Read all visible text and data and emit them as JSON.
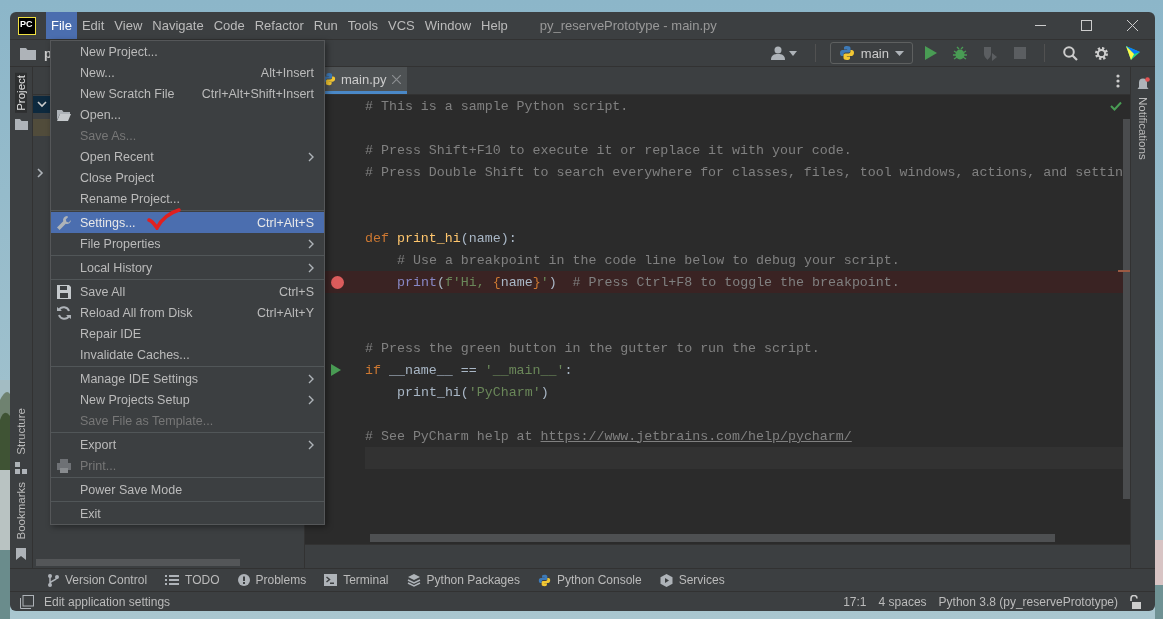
{
  "window": {
    "logo": "PC",
    "title": "py_reservePrototype - main.py"
  },
  "menu_bar": [
    {
      "label": "File",
      "selected": true
    },
    {
      "label": "Edit",
      "selected": false
    },
    {
      "label": "View",
      "selected": false
    },
    {
      "label": "Navigate",
      "selected": false
    },
    {
      "label": "Code",
      "selected": false
    },
    {
      "label": "Refactor",
      "selected": false
    },
    {
      "label": "Run",
      "selected": false
    },
    {
      "label": "Tools",
      "selected": false
    },
    {
      "label": "VCS",
      "selected": false
    },
    {
      "label": "Window",
      "selected": false
    },
    {
      "label": "Help",
      "selected": false
    }
  ],
  "navigation_bar": {
    "breadcrumb": "p"
  },
  "toolbar": {
    "run_configuration": "main"
  },
  "left_tool_stripe": [
    {
      "label": "Project",
      "selected": true
    },
    {
      "label": "Structure",
      "selected": false
    },
    {
      "label": "Bookmarks",
      "selected": false
    }
  ],
  "right_tool_stripe": [
    {
      "label": "Notifications",
      "selected": false
    }
  ],
  "editor": {
    "tabs": [
      {
        "label": "main.py",
        "selected": true
      }
    ],
    "lines": [
      {
        "kind": "code",
        "segments": [
          {
            "text": "# This is a sample Python script.",
            "kind": "comment"
          }
        ]
      },
      {
        "kind": "blank"
      },
      {
        "kind": "code",
        "segments": [
          {
            "text": "# Press Shift+F10 to execute it or replace it with your code.",
            "kind": "comment"
          }
        ]
      },
      {
        "kind": "code",
        "segments": [
          {
            "text": "# Press Double Shift to search everywhere for classes, files, tool windows, actions, and settin",
            "kind": "comment"
          }
        ]
      },
      {
        "kind": "blank"
      },
      {
        "kind": "blank"
      },
      {
        "kind": "code",
        "segments": [
          {
            "text": "def ",
            "kind": "keyword"
          },
          {
            "text": "print_hi",
            "kind": "function"
          },
          {
            "text": "(name):",
            "kind": "plain"
          }
        ],
        "children": [
          {
            "kind": "code",
            "segments": [
              {
                "text": "# Use a breakpoint in the code line below to debug your script.",
                "kind": "comment"
              }
            ]
          },
          {
            "kind": "breakpoint",
            "segments": [
              {
                "text": "print",
                "kind": "builtin"
              },
              {
                "text": "(",
                "kind": "plain"
              },
              {
                "text": "f'Hi, ",
                "kind": "string"
              },
              {
                "text": "{",
                "kind": "keyword"
              },
              {
                "text": "name",
                "kind": "plain"
              },
              {
                "text": "}",
                "kind": "keyword"
              },
              {
                "text": "'",
                "kind": "string"
              },
              {
                "text": ")  ",
                "kind": "plain"
              },
              {
                "text": "# Press Ctrl+F8 to toggle the breakpoint.",
                "kind": "comment"
              }
            ]
          }
        ]
      },
      {
        "kind": "blank"
      },
      {
        "kind": "blank"
      },
      {
        "kind": "code",
        "segments": [
          {
            "text": "# Press the green button in the gutter to run the script.",
            "kind": "comment"
          }
        ]
      },
      {
        "kind": "run",
        "segments": [
          {
            "text": "if",
            "kind": "keyword"
          },
          {
            "text": " __name__ == ",
            "kind": "plain"
          },
          {
            "text": "'__main__'",
            "kind": "string"
          },
          {
            "text": ":",
            "kind": "plain"
          }
        ],
        "children": [
          {
            "kind": "code",
            "segments": [
              {
                "text": "print_hi(",
                "kind": "plain"
              },
              {
                "text": "'PyCharm'",
                "kind": "string"
              },
              {
                "text": ")",
                "kind": "plain"
              }
            ]
          }
        ]
      },
      {
        "kind": "blank"
      },
      {
        "kind": "code",
        "segments": [
          {
            "text": "# See PyCharm help at ",
            "kind": "comment"
          },
          {
            "text": "https://www.jetbrains.com/help/pycharm/",
            "kind": "link"
          }
        ]
      },
      {
        "kind": "current"
      }
    ]
  },
  "file_menu": [
    {
      "kind": "item",
      "label": "New Project...",
      "disabled": false,
      "selected": false,
      "submenu": false,
      "annotated": false
    },
    {
      "kind": "item",
      "label": "New...",
      "shortcut": "Alt+Insert",
      "disabled": false,
      "selected": false,
      "submenu": false,
      "annotated": false
    },
    {
      "kind": "item",
      "label": "New Scratch File",
      "shortcut": "Ctrl+Alt+Shift+Insert",
      "disabled": false,
      "selected": false,
      "submenu": false,
      "annotated": false
    },
    {
      "kind": "item",
      "label": "Open...",
      "disabled": false,
      "selected": false,
      "submenu": false,
      "annotated": false
    },
    {
      "kind": "item",
      "label": "Save As...",
      "disabled": true,
      "selected": false,
      "submenu": false,
      "annotated": false
    },
    {
      "kind": "item",
      "label": "Open Recent",
      "disabled": false,
      "selected": false,
      "submenu": true,
      "annotated": false
    },
    {
      "kind": "item",
      "label": "Close Project",
      "disabled": false,
      "selected": false,
      "submenu": false,
      "annotated": false
    },
    {
      "kind": "item",
      "label": "Rename Project...",
      "disabled": false,
      "selected": false,
      "submenu": false,
      "annotated": false
    },
    {
      "kind": "separator"
    },
    {
      "kind": "item",
      "label": "Settings...",
      "shortcut": "Ctrl+Alt+S",
      "disabled": false,
      "selected": true,
      "submenu": false,
      "annotated": true
    },
    {
      "kind": "item",
      "label": "File Properties",
      "disabled": false,
      "selected": false,
      "submenu": true,
      "annotated": false
    },
    {
      "kind": "separator"
    },
    {
      "kind": "item",
      "label": "Local History",
      "disabled": false,
      "selected": false,
      "submenu": true,
      "annotated": false
    },
    {
      "kind": "separator"
    },
    {
      "kind": "item",
      "label": "Save All",
      "shortcut": "Ctrl+S",
      "disabled": false,
      "selected": false,
      "submenu": false,
      "annotated": false
    },
    {
      "kind": "item",
      "label": "Reload All from Disk",
      "shortcut": "Ctrl+Alt+Y",
      "disabled": false,
      "selected": false,
      "submenu": false,
      "annotated": false
    },
    {
      "kind": "item",
      "label": "Repair IDE",
      "disabled": false,
      "selected": false,
      "submenu": false,
      "annotated": false
    },
    {
      "kind": "item",
      "label": "Invalidate Caches...",
      "disabled": false,
      "selected": false,
      "submenu": false,
      "annotated": false
    },
    {
      "kind": "separator"
    },
    {
      "kind": "item",
      "label": "Manage IDE Settings",
      "disabled": false,
      "selected": false,
      "submenu": true,
      "annotated": false
    },
    {
      "kind": "item",
      "label": "New Projects Setup",
      "disabled": false,
      "selected": false,
      "submenu": true,
      "annotated": false
    },
    {
      "kind": "item",
      "label": "Save File as Template...",
      "disabled": true,
      "selected": false,
      "submenu": false,
      "annotated": false
    },
    {
      "kind": "separator"
    },
    {
      "kind": "item",
      "label": "Export",
      "disabled": false,
      "selected": false,
      "submenu": true,
      "annotated": false
    },
    {
      "kind": "item",
      "label": "Print...",
      "disabled": true,
      "selected": false,
      "submenu": false,
      "annotated": false
    },
    {
      "kind": "separator"
    },
    {
      "kind": "item",
      "label": "Power Save Mode",
      "disabled": false,
      "selected": false,
      "submenu": false,
      "annotated": false
    },
    {
      "kind": "separator"
    },
    {
      "kind": "item",
      "label": "Exit",
      "disabled": false,
      "selected": false,
      "submenu": false,
      "annotated": false
    }
  ],
  "tool_windows": [
    {
      "label": "Version Control"
    },
    {
      "label": "TODO"
    },
    {
      "label": "Problems"
    },
    {
      "label": "Terminal"
    },
    {
      "label": "Python Packages"
    },
    {
      "label": "Python Console"
    },
    {
      "label": "Services"
    }
  ],
  "status_bar": {
    "message": "Edit application settings",
    "position": "17:1",
    "indent": "4 spaces",
    "interpreter": "Python 3.8 (py_reservePrototype)"
  }
}
